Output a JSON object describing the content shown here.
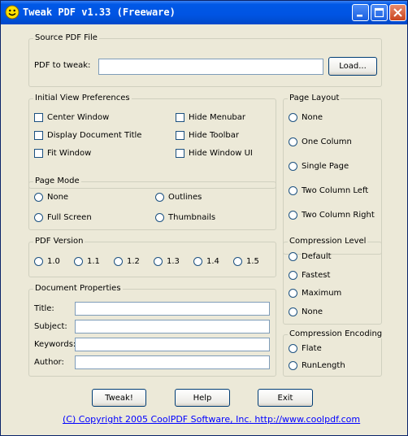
{
  "window": {
    "title": "Tweak PDF v1.33 (Freeware)"
  },
  "source_group": {
    "legend": "Source PDF File",
    "field_label": "PDF to tweak:",
    "field_value": "",
    "load_label": "Load..."
  },
  "view_prefs": {
    "legend": "Initial View Preferences",
    "items": [
      {
        "label": "Center Window",
        "checked": false
      },
      {
        "label": "Display Document Title",
        "checked": false
      },
      {
        "label": "Fit Window",
        "checked": false
      },
      {
        "label": "Hide Menubar",
        "checked": false
      },
      {
        "label": "Hide Toolbar",
        "checked": false
      },
      {
        "label": "Hide Window UI",
        "checked": false
      }
    ]
  },
  "page_layout": {
    "legend": "Page Layout",
    "options": [
      "None",
      "One Column",
      "Single Page",
      "Two Column Left",
      "Two Column Right"
    ]
  },
  "page_mode": {
    "legend": "Page Mode",
    "options": [
      "None",
      "Outlines",
      "Full Screen",
      "Thumbnails"
    ]
  },
  "pdf_version": {
    "legend": "PDF Version",
    "options": [
      "1.0",
      "1.1",
      "1.2",
      "1.3",
      "1.4",
      "1.5"
    ]
  },
  "compression_level": {
    "legend": "Compression Level",
    "options": [
      "Default",
      "Fastest",
      "Maximum",
      "None"
    ]
  },
  "doc_props": {
    "legend": "Document Properties",
    "fields": [
      {
        "label": "Title:",
        "value": ""
      },
      {
        "label": "Subject:",
        "value": ""
      },
      {
        "label": "Keywords:",
        "value": ""
      },
      {
        "label": "Author:",
        "value": ""
      }
    ]
  },
  "compression_encoding": {
    "legend": "Compression Encoding",
    "options": [
      "Flate",
      "RunLength"
    ]
  },
  "buttons": {
    "tweak": "Tweak!",
    "help": "Help",
    "exit": "Exit"
  },
  "footer": {
    "copyright": "(C) Copyright 2005 CoolPDF Software, Inc.  http://www.coolpdf.com"
  },
  "colors": {
    "title_bar": "#0054E3",
    "dialog_bg": "#ECE9D8",
    "link": "#0000FF",
    "input_border": "#7F9DB9"
  },
  "icons": {
    "app": "smiley-icon"
  }
}
